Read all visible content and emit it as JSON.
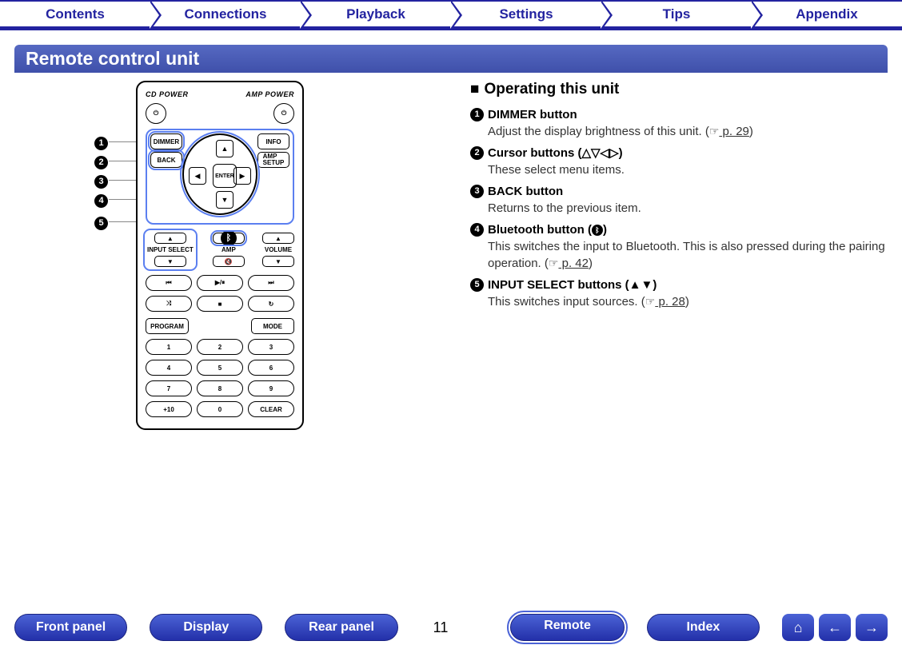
{
  "topnav": [
    "Contents",
    "Connections",
    "Playback",
    "Settings",
    "Tips",
    "Appendix"
  ],
  "title": "Remote control unit",
  "section_heading": "Operating this unit",
  "items": [
    {
      "num": "1",
      "title": "DIMMER button",
      "desc": "Adjust the display brightness of this unit. (",
      "ref": " p. 29",
      "after": ")"
    },
    {
      "num": "2",
      "title": "Cursor buttons (△▽◁▷)",
      "desc": "These select menu items.",
      "ref": "",
      "after": ""
    },
    {
      "num": "3",
      "title": "BACK button",
      "desc": "Returns to the previous item.",
      "ref": "",
      "after": ""
    },
    {
      "num": "4",
      "title": "Bluetooth button (",
      "title_after": ")",
      "desc": "This switches the input to Bluetooth. This is also pressed during the pairing operation.  (",
      "ref": " p. 42",
      "after": ")"
    },
    {
      "num": "5",
      "title": "INPUT SELECT buttons (▲▼)",
      "desc": "This switches input sources.  (",
      "ref": " p. 28",
      "after": ")"
    }
  ],
  "remote_labels": {
    "cd_power": "CD POWER",
    "amp_power": "AMP POWER",
    "dimmer": "DIMMER",
    "info": "INFO",
    "back": "BACK",
    "amp_setup": "AMP\nSETUP",
    "enter": "ENTER",
    "input_select": "INPUT SELECT",
    "amp": "AMP",
    "volume": "VOLUME",
    "program": "PROGRAM",
    "mode": "MODE",
    "clear": "CLEAR",
    "plus10": "+10",
    "nums": [
      "1",
      "2",
      "3",
      "4",
      "5",
      "6",
      "7",
      "8",
      "9"
    ],
    "zero": "0",
    "transport": [
      "⏮",
      "▶/⏸",
      "⏭",
      "⤨",
      "■",
      "↻"
    ],
    "mute": "🔇"
  },
  "bottomnav": [
    "Front panel",
    "Display",
    "Rear panel",
    "Remote",
    "Index"
  ],
  "page": "11",
  "pointer": "☞"
}
